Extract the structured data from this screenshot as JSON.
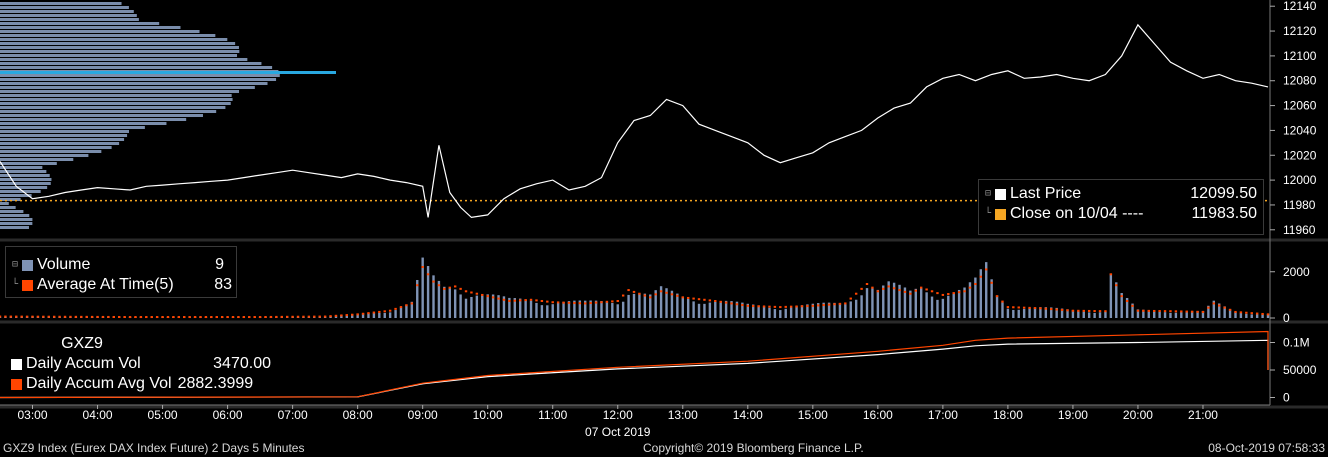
{
  "footer": {
    "left": "GXZ9 Index (Eurex DAX Index Future) 2 Days 5 Minutes",
    "center": "Copyright© 2019 Bloomberg Finance L.P.",
    "right": "08-Oct-2019 07:58:33"
  },
  "legend_price": {
    "items": [
      {
        "label": "Last Price",
        "value": "12099.50",
        "color": "#ffffff"
      },
      {
        "label": "Close on 10/04 ----",
        "value": "11983.50",
        "color": "#f5a623"
      }
    ]
  },
  "legend_volume": {
    "items": [
      {
        "label": "Volume",
        "value": "9",
        "color": "#7f93b5"
      },
      {
        "label": "Average At Time(5)",
        "value": "83",
        "color": "#ff4500"
      }
    ]
  },
  "legend_accum": {
    "title": "GXZ9",
    "items": [
      {
        "label": "Daily Accum Vol",
        "value": "3470.00",
        "color": "#ffffff"
      },
      {
        "label": "Daily Accum Avg Vol",
        "value": "2882.3999",
        "color": "#ff4500"
      }
    ]
  },
  "colors": {
    "price_line": "#ffffff",
    "close_line": "#f5a623",
    "volume_bar": "#7f93b5",
    "avg_dot": "#ff4500",
    "profile": "#8fa6c9",
    "profile_peak": "#29a8e0"
  },
  "chart_data": [
    {
      "type": "line",
      "name": "price",
      "x": [
        "02:30",
        "02:45",
        "03:00",
        "03:15",
        "03:30",
        "03:45",
        "04:00",
        "04:15",
        "04:30",
        "04:45",
        "05:00",
        "05:15",
        "05:30",
        "05:45",
        "06:00",
        "06:15",
        "06:30",
        "06:45",
        "07:00",
        "07:15",
        "07:30",
        "07:45",
        "08:00",
        "08:15",
        "08:30",
        "08:45",
        "09:00",
        "09:05",
        "09:15",
        "09:25",
        "09:35",
        "09:45",
        "10:00",
        "10:15",
        "10:30",
        "10:45",
        "11:00",
        "11:15",
        "11:30",
        "11:45",
        "12:00",
        "12:15",
        "12:30",
        "12:45",
        "13:00",
        "13:15",
        "13:30",
        "13:45",
        "14:00",
        "14:15",
        "14:30",
        "14:45",
        "15:00",
        "15:15",
        "15:30",
        "15:45",
        "16:00",
        "16:15",
        "16:30",
        "16:45",
        "17:00",
        "17:15",
        "17:30",
        "17:45",
        "18:00",
        "18:15",
        "18:30",
        "18:45",
        "19:00",
        "19:15",
        "19:30",
        "19:45",
        "20:00",
        "20:15",
        "20:30",
        "20:45",
        "21:00",
        "21:15",
        "21:30",
        "21:45",
        "22:00"
      ],
      "y": [
        12015,
        11995,
        11985,
        11987,
        11990,
        11992,
        11994,
        11993,
        11992,
        11995,
        11996,
        11997,
        11998,
        11999,
        12000,
        12002,
        12004,
        12006,
        12008,
        12006,
        12004,
        12002,
        12005,
        12003,
        12000,
        11998,
        11995,
        11970,
        12028,
        11990,
        11978,
        11970,
        11972,
        11985,
        11993,
        11997,
        12000,
        11992,
        11995,
        12002,
        12030,
        12048,
        12052,
        12065,
        12060,
        12045,
        12040,
        12035,
        12030,
        12020,
        12014,
        12018,
        12022,
        12030,
        12035,
        12040,
        12050,
        12058,
        12062,
        12075,
        12082,
        12085,
        12080,
        12085,
        12088,
        12082,
        12083,
        12085,
        12082,
        12080,
        12085,
        12100,
        12125,
        12110,
        12095,
        12088,
        12082,
        12085,
        12080,
        12078,
        12075
      ],
      "ylim": [
        11955,
        12145
      ],
      "yticks": [
        11960,
        11980,
        12000,
        12020,
        12040,
        12060,
        12080,
        12100,
        12120,
        12140
      ],
      "reference_line": {
        "label": "Close on 10/04",
        "value": 11983.5
      }
    },
    {
      "type": "bar",
      "name": "volume",
      "x_range": [
        "02:30",
        "22:00"
      ],
      "values_at": [
        [
          "02:30",
          60
        ],
        [
          "03:30",
          50
        ],
        [
          "04:30",
          40
        ],
        [
          "05:30",
          40
        ],
        [
          "06:30",
          40
        ],
        [
          "07:30",
          60
        ],
        [
          "08:00",
          150
        ],
        [
          "08:30",
          300
        ],
        [
          "08:50",
          600
        ],
        [
          "09:00",
          2100
        ],
        [
          "09:10",
          1500
        ],
        [
          "09:20",
          1200
        ],
        [
          "09:30",
          1300
        ],
        [
          "09:40",
          1100
        ],
        [
          "10:00",
          900
        ],
        [
          "10:20",
          700
        ],
        [
          "10:40",
          750
        ],
        [
          "11:00",
          650
        ],
        [
          "11:30",
          600
        ],
        [
          "12:00",
          700
        ],
        [
          "12:10",
          1150
        ],
        [
          "12:30",
          850
        ],
        [
          "12:40",
          1100
        ],
        [
          "13:00",
          850
        ],
        [
          "13:30",
          700
        ],
        [
          "14:00",
          500
        ],
        [
          "14:30",
          450
        ],
        [
          "15:00",
          500
        ],
        [
          "15:30",
          600
        ],
        [
          "15:50",
          1400
        ],
        [
          "16:00",
          1100
        ],
        [
          "16:10",
          1300
        ],
        [
          "16:30",
          1000
        ],
        [
          "16:40",
          1250
        ],
        [
          "17:00",
          950
        ],
        [
          "17:20",
          1100
        ],
        [
          "17:30",
          1400
        ],
        [
          "17:40",
          2000
        ],
        [
          "17:50",
          900
        ],
        [
          "18:00",
          450
        ],
        [
          "18:30",
          400
        ],
        [
          "19:00",
          300
        ],
        [
          "19:30",
          280
        ],
        [
          "19:35",
          1800
        ],
        [
          "19:45",
          900
        ],
        [
          "20:00",
          300
        ],
        [
          "20:30",
          280
        ],
        [
          "21:00",
          250
        ],
        [
          "21:10",
          600
        ],
        [
          "21:30",
          250
        ],
        [
          "22:00",
          150
        ]
      ],
      "yticks": [
        0,
        2000
      ],
      "ylim": [
        0,
        3200
      ]
    },
    {
      "type": "line",
      "name": "accumulated volume",
      "x": [
        "02:30",
        "08:00",
        "09:00",
        "10:00",
        "12:00",
        "14:00",
        "16:00",
        "17:00",
        "17:30",
        "18:00",
        "20:00",
        "22:00"
      ],
      "series": [
        {
          "name": "Daily Accum Vol",
          "values": [
            0,
            1000,
            25000,
            38000,
            52000,
            62000,
            78000,
            88000,
            94000,
            97000,
            100000,
            104000
          ]
        },
        {
          "name": "Daily Accum Avg Vol",
          "values": [
            0,
            1200,
            26000,
            40000,
            55000,
            66000,
            84000,
            95000,
            104000,
            108000,
            114000,
            120000
          ]
        }
      ],
      "ylim": [
        -10000,
        130000
      ],
      "yticks": [
        0,
        50000,
        100000
      ],
      "ytick_labels": [
        "0",
        "50000",
        "0.1M"
      ]
    }
  ],
  "xaxis": {
    "ticks": [
      "03:00",
      "04:00",
      "05:00",
      "06:00",
      "07:00",
      "08:00",
      "09:00",
      "10:00",
      "11:00",
      "12:00",
      "13:00",
      "14:00",
      "15:00",
      "16:00",
      "17:00",
      "18:00",
      "19:00",
      "20:00",
      "21:00"
    ],
    "date_label": "07 Oct 2019"
  }
}
